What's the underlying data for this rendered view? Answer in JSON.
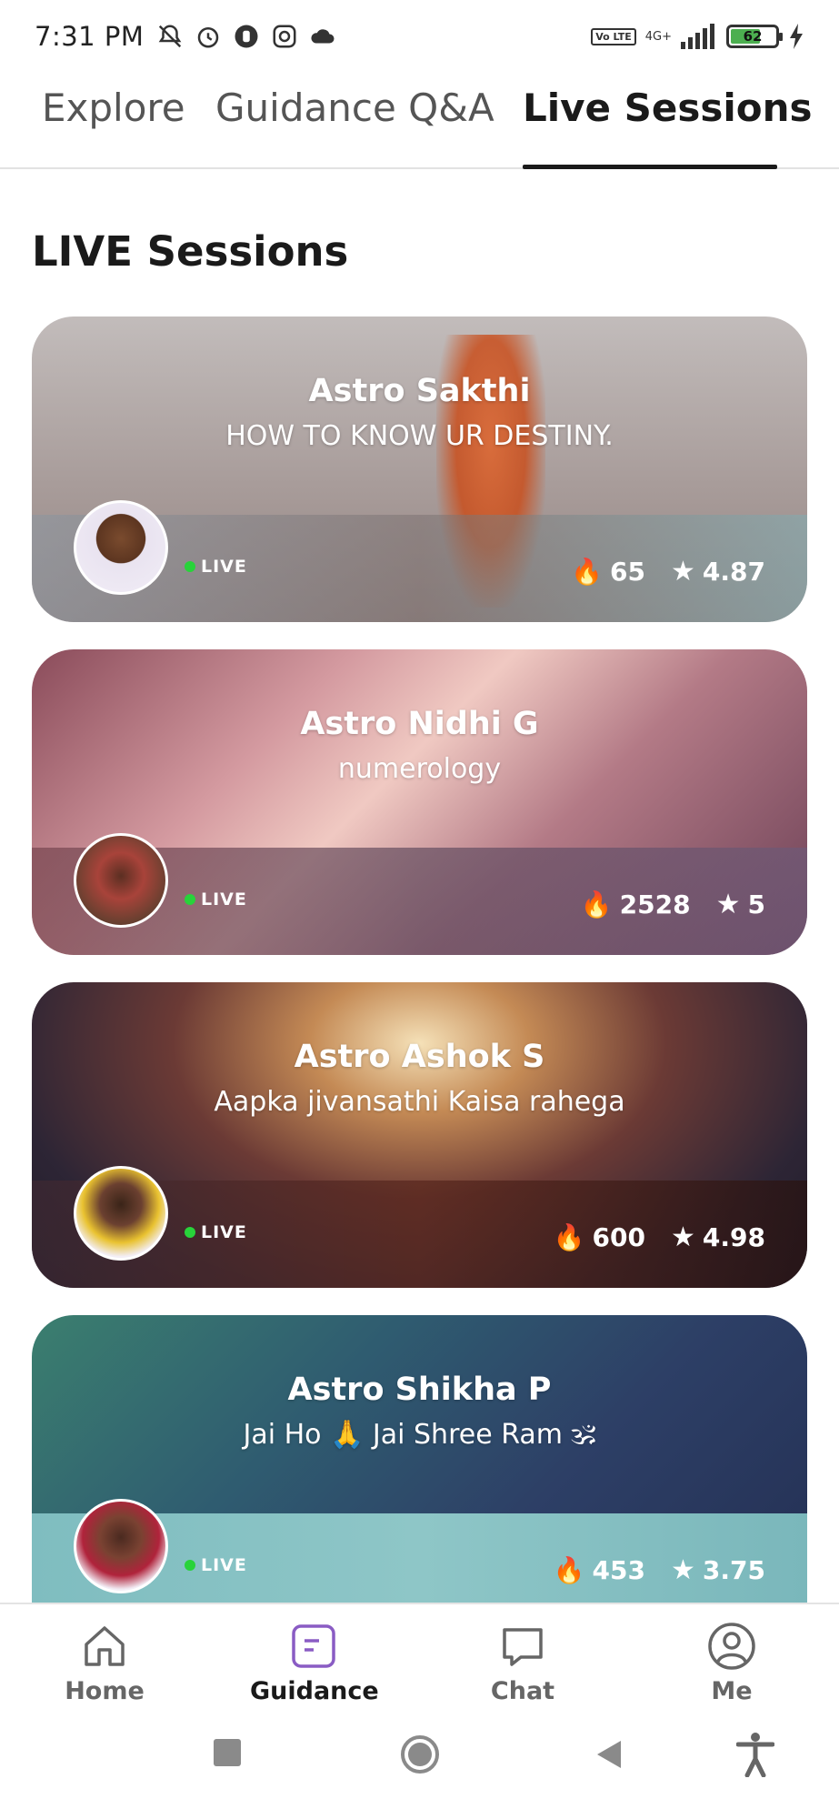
{
  "status_bar": {
    "time": "7:31 PM",
    "network": "4G+",
    "volte": "Vo LTE",
    "battery": "62"
  },
  "tabs": [
    {
      "label": "Explore",
      "active": false
    },
    {
      "label": "Guidance Q&A",
      "active": false
    },
    {
      "label": "Live Sessions",
      "active": true
    }
  ],
  "section_title": "LIVE Sessions",
  "cards": [
    {
      "name": "Astro Sakthi",
      "topic": "HOW TO KNOW UR DESTINY.",
      "live": "LIVE",
      "views": "65",
      "rating": "4.87"
    },
    {
      "name": "Astro Nidhi G",
      "topic": "numerology",
      "live": "LIVE",
      "views": "2528",
      "rating": "5"
    },
    {
      "name": "Astro Ashok S",
      "topic": "Aapka jivansathi Kaisa rahega",
      "live": "LIVE",
      "views": "600",
      "rating": "4.98"
    },
    {
      "name": "Astro Shikha P",
      "topic": "Jai Ho 🙏 Jai Shree Ram 🕉",
      "live": "LIVE",
      "views": "453",
      "rating": "3.75"
    }
  ],
  "bottom_nav": [
    {
      "label": "Home",
      "icon": "home-icon"
    },
    {
      "label": "Guidance",
      "icon": "guidance-icon",
      "active": true
    },
    {
      "label": "Chat",
      "icon": "chat-icon"
    },
    {
      "label": "Me",
      "icon": "profile-icon"
    }
  ],
  "colors": {
    "accent": "#8a5cc4",
    "live_dot": "#28d33a"
  }
}
